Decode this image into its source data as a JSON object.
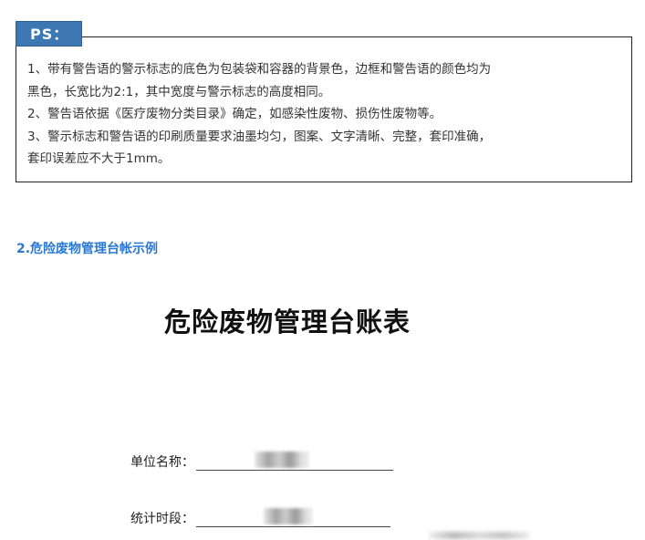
{
  "ps": {
    "tag": "PS：",
    "lines": [
      "1、带有警告语的警示标志的底色为包装袋和容器的背景色，边框和警告语的颜色均为",
      "黑色，长宽比为2:1，其中宽度与警示标志的高度相同。",
      "2、警告语依据《医疗废物分类目录》确定，如感染性废物、损伤性废物等。",
      "3、警示标志和警告语的印刷质量要求油墨均匀，图案、文字清晰、完整，套印准确，",
      "套印误差应不大于1mm。"
    ]
  },
  "section_heading": "2.危险废物管理台帐示例",
  "document": {
    "title": "危险废物管理台账表",
    "fields": [
      {
        "label": "单位名称：",
        "blank_prefix": "__"
      },
      {
        "label": "统计时段：",
        "blank_prefix": "__"
      }
    ]
  },
  "colors": {
    "tag_background": "#3e78b2",
    "heading": "#2a78d6",
    "border": "#222222"
  }
}
